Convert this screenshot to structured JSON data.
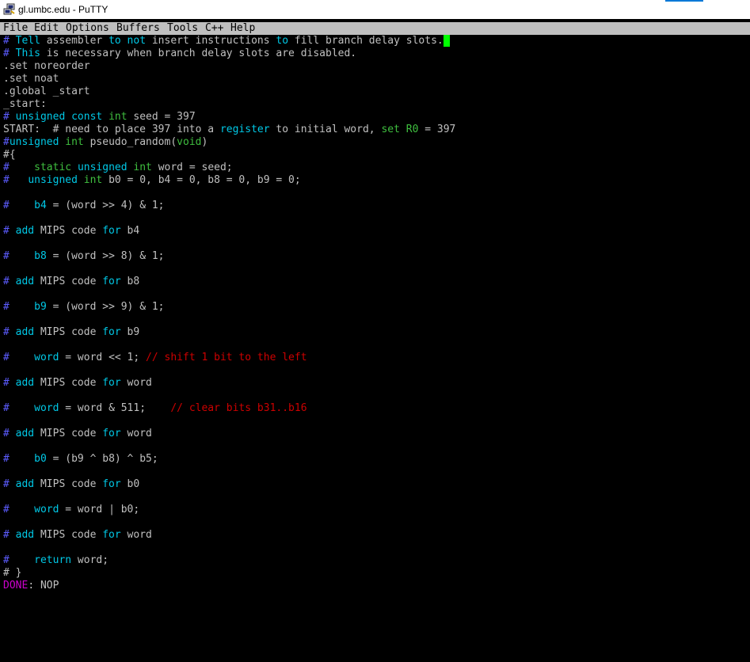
{
  "window": {
    "title": "gl.umbc.edu - PuTTY",
    "icon": "putty-icon"
  },
  "menu": [
    "File",
    "Edit",
    "Options",
    "Buffers",
    "Tools",
    "C++",
    "Help"
  ],
  "lines": [
    [
      [
        "c-com",
        "# "
      ],
      [
        "c-kw",
        "Tell"
      ],
      [
        "c-w",
        " assembler "
      ],
      [
        "c-kw",
        "to"
      ],
      [
        "c-w",
        " "
      ],
      [
        "c-kw",
        "not"
      ],
      [
        "c-w",
        " insert instructions "
      ],
      [
        "c-kw",
        "to"
      ],
      [
        "c-w",
        " fill branch delay slots."
      ]
    ],
    [
      [
        "c-com",
        "# "
      ],
      [
        "c-kw",
        "This"
      ],
      [
        "c-w",
        " is necessary when branch delay slots are disabled."
      ]
    ],
    [
      [
        "c-w",
        ".set noreorder"
      ]
    ],
    [
      [
        "c-w",
        ".set noat"
      ]
    ],
    [
      [
        "c-w",
        ".global _start"
      ]
    ],
    [
      [
        "c-w",
        "_start:"
      ]
    ],
    [
      [
        "c-com",
        "# "
      ],
      [
        "c-kw",
        "unsigned"
      ],
      [
        "c-w",
        " "
      ],
      [
        "c-kw",
        "const"
      ],
      [
        "c-w",
        " "
      ],
      [
        "c-ty",
        "int"
      ],
      [
        "c-w",
        " seed = 397"
      ]
    ],
    [
      [
        "c-w",
        "START:  # need to place 397 into a "
      ],
      [
        "c-kw",
        "register"
      ],
      [
        "c-w",
        " to initial word, "
      ],
      [
        "c-ty",
        "set"
      ],
      [
        "c-w",
        " "
      ],
      [
        "c-ty",
        "R0"
      ],
      [
        "c-w",
        " = 397"
      ]
    ],
    [
      [
        "c-com",
        "#"
      ],
      [
        "c-kw",
        "unsigned"
      ],
      [
        "c-w",
        " "
      ],
      [
        "c-ty",
        "int"
      ],
      [
        "c-w",
        " pseudo_random("
      ],
      [
        "c-ty",
        "void"
      ],
      [
        "c-w",
        ")"
      ]
    ],
    [
      [
        "c-w",
        "#{"
      ]
    ],
    [
      [
        "c-com",
        "#    "
      ],
      [
        "c-ty",
        "static"
      ],
      [
        "c-w",
        " "
      ],
      [
        "c-kw",
        "unsigned"
      ],
      [
        "c-w",
        " "
      ],
      [
        "c-ty",
        "int"
      ],
      [
        "c-w",
        " word = seed;"
      ]
    ],
    [
      [
        "c-com",
        "#   "
      ],
      [
        "c-kw",
        "unsigned"
      ],
      [
        "c-w",
        " "
      ],
      [
        "c-ty",
        "int"
      ],
      [
        "c-w",
        " b0 = 0, b4 = 0, b8 = 0, b9 = 0;"
      ]
    ],
    [],
    [
      [
        "c-com",
        "#    "
      ],
      [
        "c-kw",
        "b4"
      ],
      [
        "c-w",
        " = (word >> 4) & 1;"
      ]
    ],
    [],
    [
      [
        "c-com",
        "# "
      ],
      [
        "c-kw",
        "add"
      ],
      [
        "c-w",
        " MIPS code "
      ],
      [
        "c-kw",
        "for"
      ],
      [
        "c-w",
        " b4"
      ]
    ],
    [],
    [
      [
        "c-com",
        "#    "
      ],
      [
        "c-kw",
        "b8"
      ],
      [
        "c-w",
        " = (word >> 8) & 1;"
      ]
    ],
    [],
    [
      [
        "c-com",
        "# "
      ],
      [
        "c-kw",
        "add"
      ],
      [
        "c-w",
        " MIPS code "
      ],
      [
        "c-kw",
        "for"
      ],
      [
        "c-w",
        " b8"
      ]
    ],
    [],
    [
      [
        "c-com",
        "#    "
      ],
      [
        "c-kw",
        "b9"
      ],
      [
        "c-w",
        " = (word >> 9) & 1;"
      ]
    ],
    [],
    [
      [
        "c-com",
        "# "
      ],
      [
        "c-kw",
        "add"
      ],
      [
        "c-w",
        " MIPS code "
      ],
      [
        "c-kw",
        "for"
      ],
      [
        "c-w",
        " b9"
      ]
    ],
    [],
    [
      [
        "c-com",
        "#    "
      ],
      [
        "c-kw",
        "word"
      ],
      [
        "c-w",
        " = word << 1; "
      ],
      [
        "c-red",
        "// shift 1 bit to the left"
      ]
    ],
    [],
    [
      [
        "c-com",
        "# "
      ],
      [
        "c-kw",
        "add"
      ],
      [
        "c-w",
        " MIPS code "
      ],
      [
        "c-kw",
        "for"
      ],
      [
        "c-w",
        " word"
      ]
    ],
    [],
    [
      [
        "c-com",
        "#    "
      ],
      [
        "c-kw",
        "word"
      ],
      [
        "c-w",
        " = word & 511;    "
      ],
      [
        "c-red",
        "// clear bits b31..b16"
      ]
    ],
    [],
    [
      [
        "c-com",
        "# "
      ],
      [
        "c-kw",
        "add"
      ],
      [
        "c-w",
        " MIPS code "
      ],
      [
        "c-kw",
        "for"
      ],
      [
        "c-w",
        " word"
      ]
    ],
    [],
    [
      [
        "c-com",
        "#    "
      ],
      [
        "c-kw",
        "b0"
      ],
      [
        "c-w",
        " = (b9 ^ b8) ^ b5;"
      ]
    ],
    [],
    [
      [
        "c-com",
        "# "
      ],
      [
        "c-kw",
        "add"
      ],
      [
        "c-w",
        " MIPS code "
      ],
      [
        "c-kw",
        "for"
      ],
      [
        "c-w",
        " b0"
      ]
    ],
    [],
    [
      [
        "c-com",
        "#    "
      ],
      [
        "c-kw",
        "word"
      ],
      [
        "c-w",
        " = word | b0;"
      ]
    ],
    [],
    [
      [
        "c-com",
        "# "
      ],
      [
        "c-kw",
        "add"
      ],
      [
        "c-w",
        " MIPS code "
      ],
      [
        "c-kw",
        "for"
      ],
      [
        "c-w",
        " word"
      ]
    ],
    [],
    [
      [
        "c-com",
        "#    "
      ],
      [
        "c-kw",
        "return"
      ],
      [
        "c-w",
        " word;"
      ]
    ],
    [
      [
        "c-w",
        "# }"
      ]
    ],
    [
      [
        "c-mag",
        "DONE"
      ],
      [
        "c-w",
        ": NOP"
      ]
    ]
  ],
  "colors": {
    "comment": "#5c5cff",
    "keyword": "#00c8e6",
    "type": "#3fbf3f",
    "red": "#cd0000",
    "magenta": "#cd00cd",
    "cursor": "#00ff00"
  }
}
